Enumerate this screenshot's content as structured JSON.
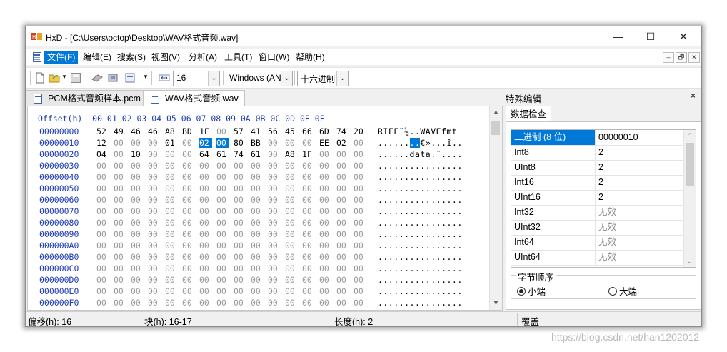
{
  "window": {
    "title": "HxD - [C:\\Users\\octop\\Desktop\\WAV格式音频.wav]",
    "minimize": "—",
    "maximize": "☐",
    "close": "✕"
  },
  "menu": {
    "items": [
      "文件(F)",
      "编辑(E)",
      "搜索(S)",
      "视图(V)",
      "分析(A)",
      "工具(T)",
      "窗口(W)",
      "帮助(H)"
    ],
    "active_index": 0,
    "mdi": [
      "–",
      "🗗",
      "✕"
    ]
  },
  "toolbar": {
    "bytes_per_row": "16",
    "charset": "Windows (AN",
    "number_base": "十六进制"
  },
  "tabs": [
    {
      "label": "PCM格式音频样本.pcm",
      "active": false
    },
    {
      "label": "WAV格式音频.wav",
      "active": true
    }
  ],
  "hex": {
    "header": "Offset(h)  00 01 02 03 04 05 06 07 08 09 0A 0B 0C 0D 0E 0F",
    "rows": [
      {
        "offset": "00000000",
        "bytes": [
          "52",
          "49",
          "46",
          "46",
          "A8",
          "BD",
          "1F",
          "00",
          "57",
          "41",
          "56",
          "45",
          "66",
          "6D",
          "74",
          "20"
        ],
        "text": "RIFF¨½..WAVEfmt "
      },
      {
        "offset": "00000010",
        "bytes": [
          "12",
          "00",
          "00",
          "00",
          "01",
          "00",
          "02",
          "00",
          "80",
          "BB",
          "00",
          "00",
          "00",
          "EE",
          "02",
          "00"
        ],
        "text": "........€»...î.."
      },
      {
        "offset": "00000020",
        "bytes": [
          "04",
          "00",
          "10",
          "00",
          "00",
          "00",
          "64",
          "61",
          "74",
          "61",
          "00",
          "A8",
          "1F",
          "00",
          "00",
          "00"
        ],
        "text": "......data.¨...."
      },
      {
        "offset": "00000030",
        "bytes": [
          "00",
          "00",
          "00",
          "00",
          "00",
          "00",
          "00",
          "00",
          "00",
          "00",
          "00",
          "00",
          "00",
          "00",
          "00",
          "00"
        ],
        "text": "................"
      },
      {
        "offset": "00000040",
        "bytes": [
          "00",
          "00",
          "00",
          "00",
          "00",
          "00",
          "00",
          "00",
          "00",
          "00",
          "00",
          "00",
          "00",
          "00",
          "00",
          "00"
        ],
        "text": "................"
      },
      {
        "offset": "00000050",
        "bytes": [
          "00",
          "00",
          "00",
          "00",
          "00",
          "00",
          "00",
          "00",
          "00",
          "00",
          "00",
          "00",
          "00",
          "00",
          "00",
          "00"
        ],
        "text": "................"
      },
      {
        "offset": "00000060",
        "bytes": [
          "00",
          "00",
          "00",
          "00",
          "00",
          "00",
          "00",
          "00",
          "00",
          "00",
          "00",
          "00",
          "00",
          "00",
          "00",
          "00"
        ],
        "text": "................"
      },
      {
        "offset": "00000070",
        "bytes": [
          "00",
          "00",
          "00",
          "00",
          "00",
          "00",
          "00",
          "00",
          "00",
          "00",
          "00",
          "00",
          "00",
          "00",
          "00",
          "00"
        ],
        "text": "................"
      },
      {
        "offset": "00000080",
        "bytes": [
          "00",
          "00",
          "00",
          "00",
          "00",
          "00",
          "00",
          "00",
          "00",
          "00",
          "00",
          "00",
          "00",
          "00",
          "00",
          "00"
        ],
        "text": "................"
      },
      {
        "offset": "00000090",
        "bytes": [
          "00",
          "00",
          "00",
          "00",
          "00",
          "00",
          "00",
          "00",
          "00",
          "00",
          "00",
          "00",
          "00",
          "00",
          "00",
          "00"
        ],
        "text": "................"
      },
      {
        "offset": "000000A0",
        "bytes": [
          "00",
          "00",
          "00",
          "00",
          "00",
          "00",
          "00",
          "00",
          "00",
          "00",
          "00",
          "00",
          "00",
          "00",
          "00",
          "00"
        ],
        "text": "................"
      },
      {
        "offset": "000000B0",
        "bytes": [
          "00",
          "00",
          "00",
          "00",
          "00",
          "00",
          "00",
          "00",
          "00",
          "00",
          "00",
          "00",
          "00",
          "00",
          "00",
          "00"
        ],
        "text": "................"
      },
      {
        "offset": "000000C0",
        "bytes": [
          "00",
          "00",
          "00",
          "00",
          "00",
          "00",
          "00",
          "00",
          "00",
          "00",
          "00",
          "00",
          "00",
          "00",
          "00",
          "00"
        ],
        "text": "................"
      },
      {
        "offset": "000000D0",
        "bytes": [
          "00",
          "00",
          "00",
          "00",
          "00",
          "00",
          "00",
          "00",
          "00",
          "00",
          "00",
          "00",
          "00",
          "00",
          "00",
          "00"
        ],
        "text": "................"
      },
      {
        "offset": "000000E0",
        "bytes": [
          "00",
          "00",
          "00",
          "00",
          "00",
          "00",
          "00",
          "00",
          "00",
          "00",
          "00",
          "00",
          "00",
          "00",
          "00",
          "00"
        ],
        "text": "................"
      },
      {
        "offset": "000000F0",
        "bytes": [
          "00",
          "00",
          "00",
          "00",
          "00",
          "00",
          "00",
          "00",
          "00",
          "00",
          "00",
          "00",
          "00",
          "00",
          "00",
          "00"
        ],
        "text": "................"
      }
    ],
    "selection": {
      "row": 1,
      "start": 6,
      "end": 7
    }
  },
  "panel": {
    "title": "特殊编辑",
    "close": "×",
    "tab": "数据检查",
    "rows": [
      {
        "name": "二进制 (8 位)",
        "value": "00000010",
        "selected": true,
        "invalid": false
      },
      {
        "name": "Int8",
        "value": "2",
        "selected": false,
        "invalid": false
      },
      {
        "name": "UInt8",
        "value": "2",
        "selected": false,
        "invalid": false
      },
      {
        "name": "Int16",
        "value": "2",
        "selected": false,
        "invalid": false
      },
      {
        "name": "UInt16",
        "value": "2",
        "selected": false,
        "invalid": false
      },
      {
        "name": "Int32",
        "value": "无效",
        "selected": false,
        "invalid": true
      },
      {
        "name": "UInt32",
        "value": "无效",
        "selected": false,
        "invalid": true
      },
      {
        "name": "Int64",
        "value": "无效",
        "selected": false,
        "invalid": true
      },
      {
        "name": "UInt64",
        "value": "无效",
        "selected": false,
        "invalid": true
      }
    ],
    "byte_order": {
      "legend": "字节顺序",
      "little": "小端",
      "big": "大端",
      "selected": "little"
    }
  },
  "status": {
    "offset": "偏移(h): 16",
    "block": "块(h): 16-17",
    "length": "长度(h): 2",
    "mode": "覆盖"
  },
  "watermark": "https://blog.csdn.net/han1202012",
  "colors": {
    "selection": "#0078d7",
    "offset_text": "#1e3cb4",
    "zero_byte": "#9a9a9a"
  }
}
